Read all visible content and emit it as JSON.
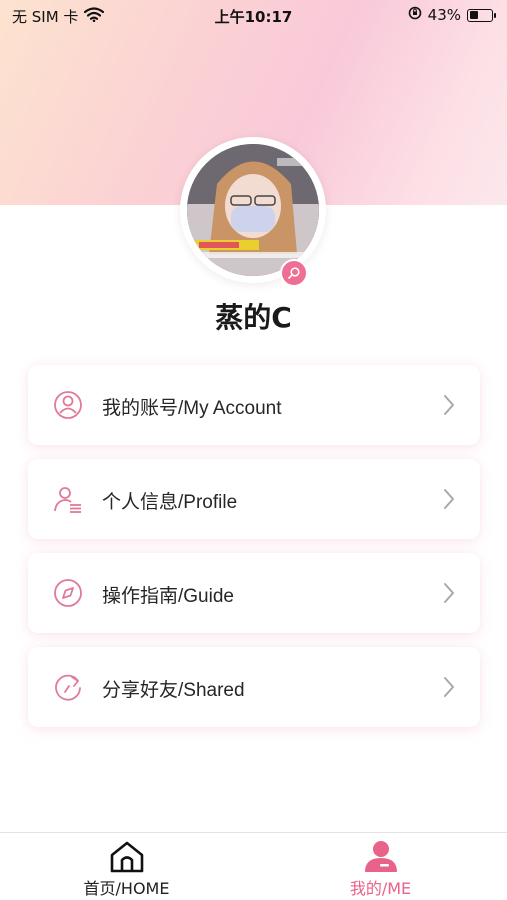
{
  "status_bar": {
    "carrier": "无 SIM 卡",
    "time": "上午10:17",
    "battery": "43%",
    "battery_level": 0.43
  },
  "profile": {
    "username": "蒸的C",
    "avatar_icon": "profile-photo",
    "badge_icon": "search-icon"
  },
  "menu": [
    {
      "label": "我的账号/My Account",
      "icon": "user-circle-icon"
    },
    {
      "label": "个人信息/Profile",
      "icon": "user-list-icon"
    },
    {
      "label": "操作指南/Guide",
      "icon": "compass-icon"
    },
    {
      "label": "分享好友/Shared",
      "icon": "share-refresh-icon"
    }
  ],
  "tabbar": {
    "home_label": "首页/HOME",
    "me_label": "我的/ME",
    "active": "me"
  },
  "colors": {
    "accent": "#e8628a",
    "icon_pink": "#e07a98",
    "chevron": "#a8a8a8"
  }
}
